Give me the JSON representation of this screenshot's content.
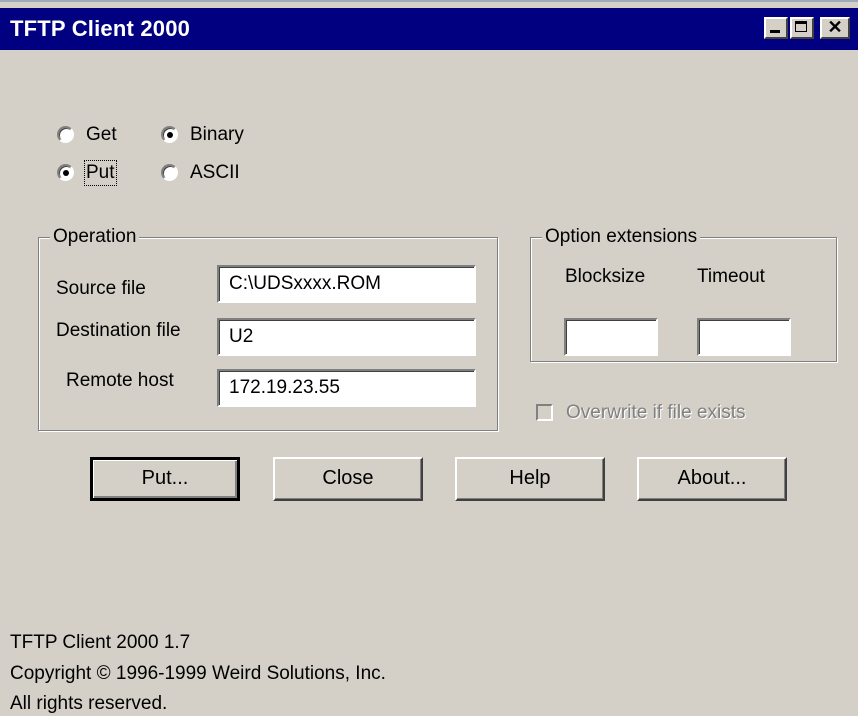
{
  "window": {
    "title": "TFTP Client 2000"
  },
  "mode": {
    "get_label": "Get",
    "put_label": "Put",
    "selected": "Put"
  },
  "transfer": {
    "binary_label": "Binary",
    "ascii_label": "ASCII",
    "selected": "Binary"
  },
  "operation": {
    "legend": "Operation",
    "source_label": "Source file",
    "source_value": "C:\\UDSxxxx.ROM",
    "destination_label": "Destination file",
    "destination_value": "U2",
    "remote_label": "Remote host",
    "remote_value": "172.19.23.55"
  },
  "options": {
    "legend": "Option extensions",
    "blocksize_label": "Blocksize",
    "blocksize_value": "",
    "timeout_label": "Timeout",
    "timeout_value": ""
  },
  "overwrite": {
    "label": "Overwrite if file exists",
    "checked": false,
    "enabled": false
  },
  "buttons": {
    "put": "Put...",
    "close": "Close",
    "help": "Help",
    "about": "About..."
  },
  "footer": {
    "version": "TFTP Client 2000 1.7",
    "copyright": "Copyright © 1996-1999 Weird Solutions, Inc.",
    "rights": "All rights reserved."
  },
  "colors": {
    "titlebar": "#000080",
    "face": "#d4d0c8"
  }
}
